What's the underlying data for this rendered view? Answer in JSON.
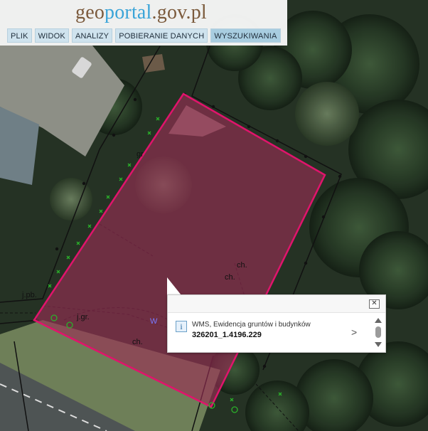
{
  "brand": {
    "geo": "geo",
    "portal": "portal",
    "domain": ".gov.pl"
  },
  "menu": [
    {
      "label": "PLIK"
    },
    {
      "label": "WIDOK"
    },
    {
      "label": "ANALIZY"
    },
    {
      "label": "POBIERANIE DANYCH"
    },
    {
      "label": "WYSZUKIWANIA"
    }
  ],
  "map_labels": {
    "ch_1": "ch.",
    "ch_2": "ch.",
    "ch_3": "ch.",
    "jpb": "j.pb.",
    "jgr": "j.gr.",
    "gr": "gr",
    "w": "W"
  },
  "popup": {
    "close_icon": "close-icon",
    "info_icon": "info-icon",
    "label": "WMS, Ewidencja gruntów i budynków",
    "value": "326201_1.4196.229",
    "next_icon": "chevron-right-icon"
  },
  "colors": {
    "parcel_outline": "#e0146c",
    "parcel_fill": "#9b2d55",
    "boundary_points": "#2bb12b"
  }
}
